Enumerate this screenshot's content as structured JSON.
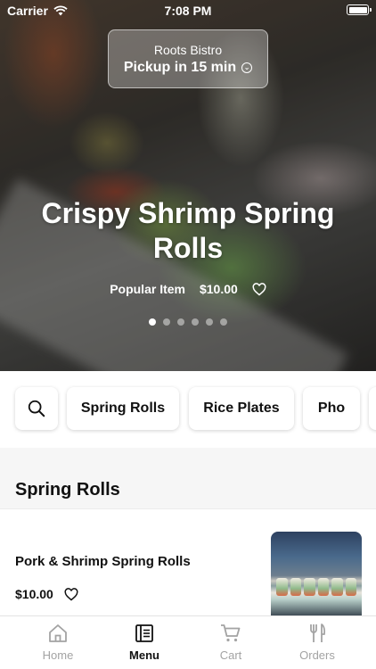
{
  "status_bar": {
    "carrier": "Carrier",
    "time": "7:08 PM"
  },
  "pickup": {
    "restaurant": "Roots Bistro",
    "label": "Pickup in 15 min"
  },
  "hero": {
    "title": "Crispy Shrimp Spring Rolls",
    "badge": "Popular Item",
    "price": "$10.00",
    "slide_count": 6,
    "active_slide": 1
  },
  "categories": [
    "Spring Rolls",
    "Rice Plates",
    "Pho"
  ],
  "section": {
    "title": "Spring Rolls",
    "items": [
      {
        "name": "Pork & Shrimp Spring Rolls",
        "price": "$10.00"
      }
    ]
  },
  "tabs": [
    {
      "label": "Home",
      "icon": "home-icon",
      "active": false
    },
    {
      "label": "Menu",
      "icon": "menu-icon",
      "active": true
    },
    {
      "label": "Cart",
      "icon": "cart-icon",
      "active": false
    },
    {
      "label": "Orders",
      "icon": "utensils-icon",
      "active": false
    }
  ],
  "colors": {
    "accent_active": "#111111",
    "inactive_tab": "#a3a3a3",
    "background": "#f6f6f6"
  }
}
